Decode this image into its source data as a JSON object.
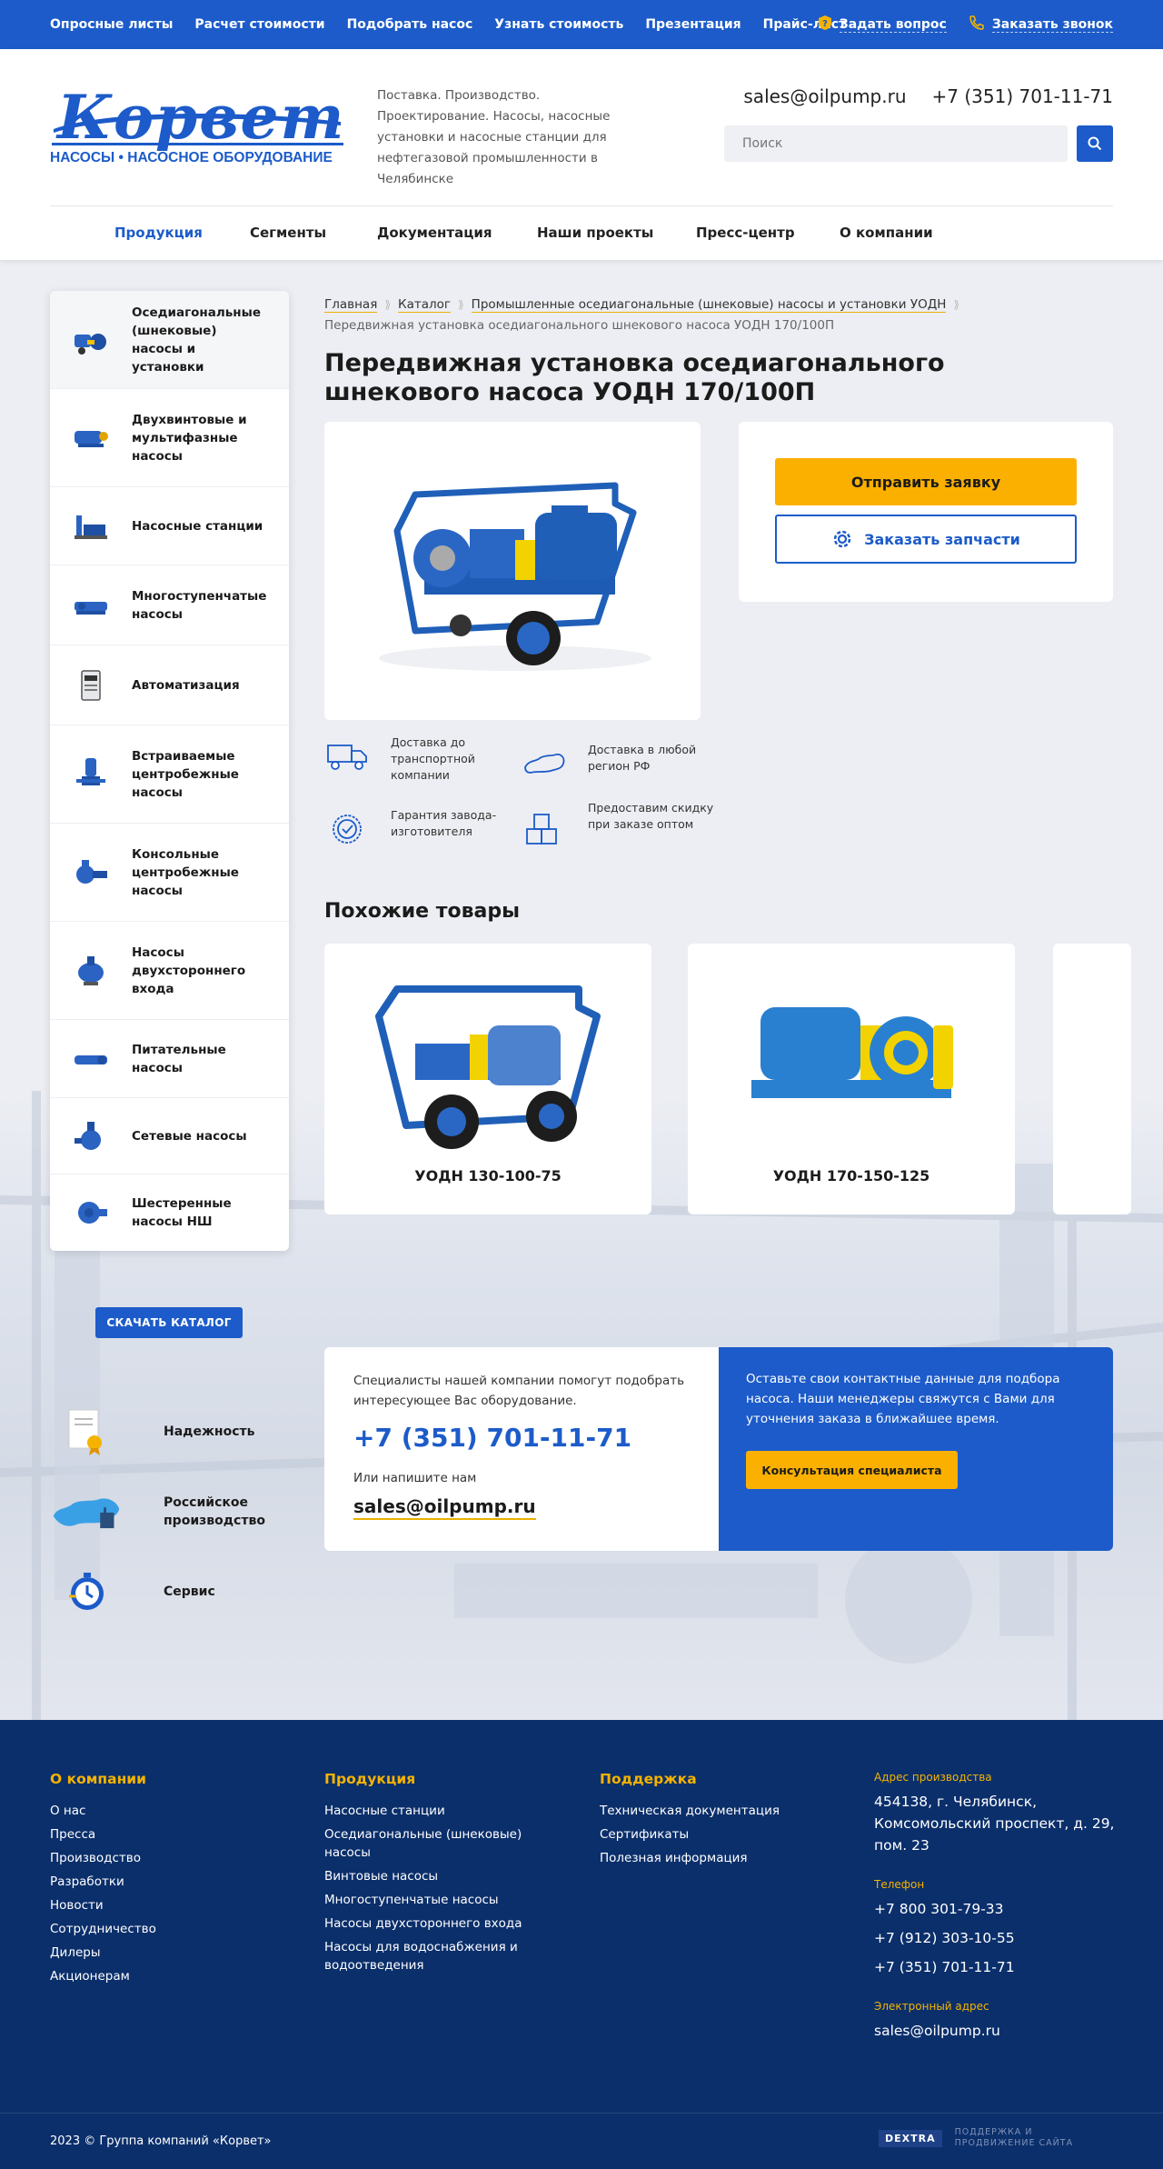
{
  "topbar": {
    "links": [
      "Опросные листы",
      "Расчет стоимости",
      "Подобрать насос",
      "Узнать стоимость",
      "Презентация",
      "Прайс-лист"
    ],
    "ask": "Задать вопрос",
    "callback": "Заказать звонок"
  },
  "header": {
    "logo_text": "Корвет",
    "logo_sub": "НАСОСЫ • НАСОСНОЕ ОБОРУДОВАНИЕ",
    "tagline": "Поставка. Производство. Проектирование. Насосы, насосные установки и насосные станции для нефтегазовой промышленности в Челябинске",
    "email": "sales@oilpump.ru",
    "phone": "+7 (351) 701-11-71",
    "search_placeholder": "Поиск"
  },
  "nav": [
    "Продукция",
    "Сегменты",
    "Документация",
    "Наши проекты",
    "Пресс-центр",
    "О компании"
  ],
  "sidebar": [
    "Оседиагональные (шнековые) насосы и установки",
    "Двухвинтовые и мультифазные насосы",
    "Насосные станции",
    "Многоступенчатые насосы",
    "Автоматизация",
    "Встраиваемые центробежные насосы",
    "Консольные центробежные насосы",
    "Насосы двухстороннего входа",
    "Питательные насосы",
    "Сетевые насосы",
    "Шестеренные насосы НШ"
  ],
  "download_catalog": "СКАЧАТЬ КАТАЛОГ",
  "features": [
    "Надежность",
    "Российское производство",
    "Сервис"
  ],
  "breadcrumbs": {
    "home": "Главная",
    "catalog": "Каталог",
    "section": "Промышленные оседиагональные (шнековые) насосы и установки УОДН",
    "current": "Передвижная установка оседиагонального шнекового насоса УОДН 170/100П"
  },
  "product": {
    "title": "Передвижная установка оседиагонального шнекового насоса УОДН 170/100П",
    "order_button": "Отправить заявку",
    "parts_button": "Заказать запчасти"
  },
  "advantages": [
    "Доставка до транспортной компании",
    "Доставка в любой регион РФ",
    "Гарантия завода-изготовителя",
    "Предоставим скидку при заказе оптом"
  ],
  "similar": {
    "heading": "Похожие товары",
    "items": [
      "УОДН 130-100-75",
      "УОДН 170-150-125"
    ]
  },
  "cta": {
    "intro": "Специалисты нашей компании помогут подобрать интересующее Вас оборудование.",
    "phone": "+7 (351) 701-11-71",
    "or_write": "Или напишите нам",
    "email": "sales@oilpump.ru",
    "blue_text": "Оставьте свои контактные данные для подбора насоса. Наши менеджеры свяжутся с Вами для уточнения заказа в ближайшее время.",
    "button": "Консультация специалиста"
  },
  "footer": {
    "about": {
      "title": "О компании",
      "links": [
        "О нас",
        "Пресса",
        "Производство",
        "Разработки",
        "Новости",
        "Сотрудничество",
        "Дилеры",
        "Акционерам"
      ]
    },
    "products": {
      "title": "Продукция",
      "links": [
        "Насосные станции",
        "Оседиагональные (шнековые) насосы",
        "Винтовые насосы",
        "Многоступенчатые насосы",
        "Насосы двухстороннего входа",
        "Насосы для водоснабжения и водоотведения"
      ]
    },
    "support": {
      "title": "Поддержка",
      "links": [
        "Техническая документация",
        "Сертификаты",
        "Полезная информация"
      ]
    },
    "address_label": "Адрес производства",
    "address": "454138, г. Челябинск, Комсомольский проспект, д. 29, пом. 23",
    "phone_label": "Телефон",
    "phones": [
      "+7 800 301-79-33",
      "+7 (912) 303-10-55",
      "+7 (351) 701-11-71"
    ],
    "email_label": "Электронный адрес",
    "email": "sales@oilpump.ru",
    "copyright": "2023 © Группа компаний «Корвет»",
    "dev_logo": "DEXTRA",
    "dev_text": "ПОДДЕРЖКА И ПРОДВИЖЕНИЕ САЙТА"
  },
  "colors": {
    "brand_blue": "#1c5bc9",
    "accent_yellow": "#fbb000",
    "footer_navy": "#0b2f6b"
  }
}
